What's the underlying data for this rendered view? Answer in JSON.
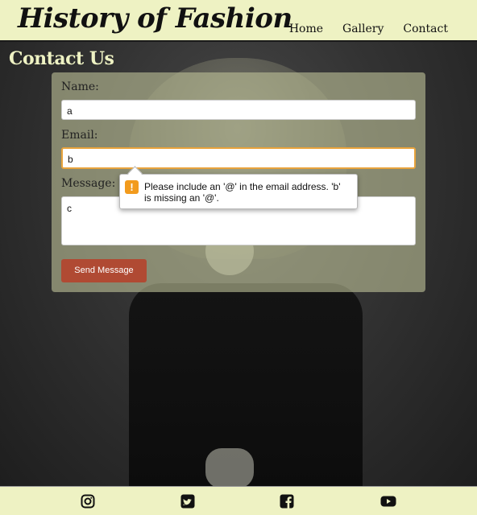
{
  "header": {
    "site_title": "History of Fashion",
    "nav": [
      "Home",
      "Gallery",
      "Contact"
    ]
  },
  "page": {
    "heading": "Contact Us"
  },
  "form": {
    "name_label": "Name:",
    "name_value": "a",
    "email_label": "Email:",
    "email_value": "b",
    "message_label": "Message:",
    "message_value": "c",
    "submit_label": "Send Message"
  },
  "validation_tooltip": {
    "message": "Please include an '@' in the email address. 'b' is missing an '@'."
  },
  "footer": {
    "social_icons": [
      "instagram-icon",
      "twitter-icon",
      "facebook-icon",
      "youtube-icon"
    ]
  },
  "colors": {
    "header_bg": "#eef2c3",
    "button_bg": "#b04a33",
    "focus_border": "#e8a33c",
    "warning": "#f29b1d"
  }
}
